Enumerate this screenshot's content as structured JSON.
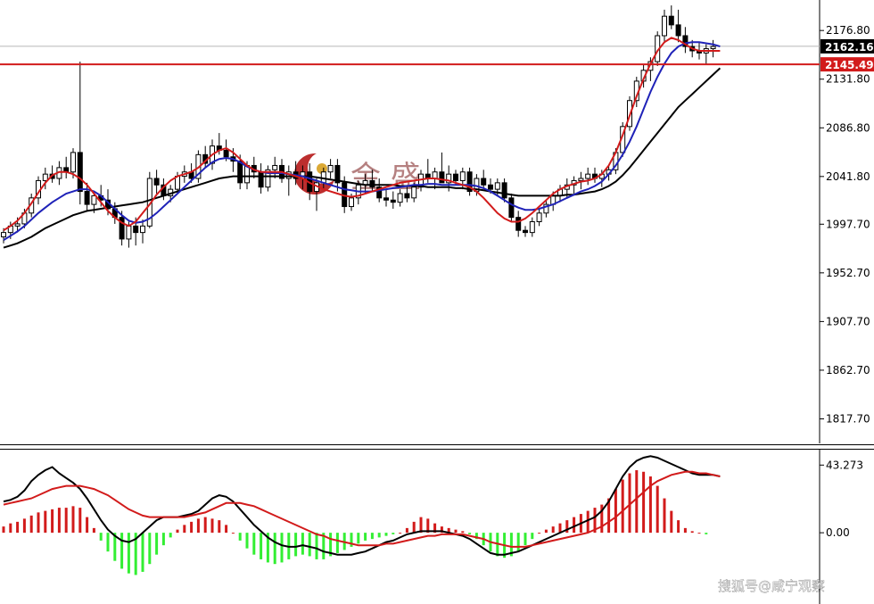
{
  "chart_data": {
    "type": "candlestick",
    "price_panel": {
      "ylim": [
        1795,
        2205
      ],
      "y_ticks": [
        "2176.80",
        "2131.80",
        "2086.80",
        "2041.80",
        "1997.70",
        "1952.70",
        "1907.70",
        "1862.70",
        "1817.70"
      ],
      "current_price": "2162.16",
      "horizontal_line_price": "2145.49",
      "candles": [
        [
          1986,
          1994,
          1980,
          1990
        ],
        [
          1990,
          2000,
          1984,
          1996
        ],
        [
          1996,
          2004,
          1990,
          1998
        ],
        [
          1998,
          2012,
          1994,
          2008
        ],
        [
          2008,
          2026,
          2004,
          2022
        ],
        [
          2022,
          2042,
          2016,
          2038
        ],
        [
          2038,
          2050,
          2030,
          2044
        ],
        [
          2044,
          2052,
          2036,
          2040
        ],
        [
          2040,
          2056,
          2034,
          2050
        ],
        [
          2050,
          2060,
          2040,
          2046
        ],
        [
          2046,
          2068,
          2040,
          2064
        ],
        [
          2064,
          2148,
          2016,
          2028
        ],
        [
          2028,
          2036,
          2010,
          2016
        ],
        [
          2016,
          2028,
          2008,
          2024
        ],
        [
          2024,
          2034,
          2014,
          2020
        ],
        [
          2020,
          2030,
          2006,
          2012
        ],
        [
          2012,
          2018,
          1998,
          2004
        ],
        [
          2004,
          2010,
          1978,
          1984
        ],
        [
          1984,
          2000,
          1976,
          1996
        ],
        [
          1996,
          2004,
          1978,
          1990
        ],
        [
          1990,
          2002,
          1980,
          1996
        ],
        [
          1996,
          2046,
          1994,
          2040
        ],
        [
          2040,
          2048,
          2026,
          2034
        ],
        [
          2034,
          2040,
          2020,
          2024
        ],
        [
          2024,
          2034,
          2018,
          2030
        ],
        [
          2030,
          2046,
          2026,
          2042
        ],
        [
          2042,
          2052,
          2036,
          2046
        ],
        [
          2046,
          2054,
          2036,
          2040
        ],
        [
          2040,
          2066,
          2036,
          2062
        ],
        [
          2062,
          2070,
          2050,
          2054
        ],
        [
          2054,
          2076,
          2048,
          2070
        ],
        [
          2070,
          2082,
          2062,
          2066
        ],
        [
          2066,
          2076,
          2056,
          2060
        ],
        [
          2060,
          2068,
          2046,
          2056
        ],
        [
          2056,
          2062,
          2030,
          2036
        ],
        [
          2036,
          2056,
          2030,
          2052
        ],
        [
          2052,
          2060,
          2040,
          2046
        ],
        [
          2046,
          2054,
          2026,
          2032
        ],
        [
          2032,
          2052,
          2028,
          2048
        ],
        [
          2048,
          2060,
          2040,
          2052
        ],
        [
          2052,
          2058,
          2036,
          2040
        ],
        [
          2040,
          2052,
          2024,
          2046
        ],
        [
          2046,
          2056,
          2034,
          2040
        ],
        [
          2040,
          2052,
          2030,
          2046
        ],
        [
          2046,
          2054,
          2020,
          2028
        ],
        [
          2028,
          2040,
          2010,
          2036
        ],
        [
          2036,
          2050,
          2030,
          2046
        ],
        [
          2046,
          2058,
          2040,
          2052
        ],
        [
          2052,
          2058,
          2028,
          2036
        ],
        [
          2036,
          2042,
          2008,
          2014
        ],
        [
          2014,
          2026,
          2010,
          2022
        ],
        [
          2022,
          2038,
          2016,
          2034
        ],
        [
          2034,
          2044,
          2026,
          2038
        ],
        [
          2038,
          2048,
          2028,
          2032
        ],
        [
          2032,
          2040,
          2018,
          2022
        ],
        [
          2022,
          2030,
          2014,
          2020
        ],
        [
          2020,
          2028,
          2012,
          2018
        ],
        [
          2018,
          2030,
          2014,
          2026
        ],
        [
          2026,
          2034,
          2018,
          2022
        ],
        [
          2022,
          2036,
          2018,
          2032
        ],
        [
          2032,
          2048,
          2028,
          2044
        ],
        [
          2044,
          2058,
          2036,
          2040
        ],
        [
          2040,
          2050,
          2030,
          2046
        ],
        [
          2046,
          2064,
          2040,
          2036
        ],
        [
          2036,
          2052,
          2028,
          2044
        ],
        [
          2044,
          2048,
          2034,
          2038
        ],
        [
          2038,
          2050,
          2030,
          2046
        ],
        [
          2046,
          2050,
          2024,
          2028
        ],
        [
          2028,
          2044,
          2024,
          2040
        ],
        [
          2040,
          2048,
          2030,
          2034
        ],
        [
          2034,
          2040,
          2026,
          2030
        ],
        [
          2030,
          2040,
          2024,
          2036
        ],
        [
          2036,
          2040,
          2018,
          2022
        ],
        [
          2022,
          2026,
          2000,
          2004
        ],
        [
          2004,
          2010,
          1986,
          1992
        ],
        [
          1992,
          1996,
          1986,
          1990
        ],
        [
          1990,
          2004,
          1986,
          2000
        ],
        [
          2000,
          2012,
          1996,
          2008
        ],
        [
          2008,
          2020,
          2004,
          2016
        ],
        [
          2016,
          2028,
          2010,
          2024
        ],
        [
          2024,
          2034,
          2018,
          2030
        ],
        [
          2030,
          2040,
          2022,
          2034
        ],
        [
          2034,
          2042,
          2026,
          2038
        ],
        [
          2038,
          2046,
          2030,
          2040
        ],
        [
          2040,
          2050,
          2034,
          2044
        ],
        [
          2044,
          2050,
          2036,
          2040
        ],
        [
          2040,
          2048,
          2032,
          2044
        ],
        [
          2044,
          2052,
          2038,
          2048
        ],
        [
          2048,
          2068,
          2044,
          2064
        ],
        [
          2064,
          2092,
          2060,
          2088
        ],
        [
          2088,
          2116,
          2084,
          2112
        ],
        [
          2112,
          2134,
          2106,
          2130
        ],
        [
          2130,
          2146,
          2124,
          2140
        ],
        [
          2140,
          2152,
          2130,
          2148
        ],
        [
          2148,
          2176,
          2144,
          2172
        ],
        [
          2172,
          2196,
          2166,
          2190
        ],
        [
          2190,
          2200,
          2178,
          2182
        ],
        [
          2182,
          2196,
          2166,
          2172
        ],
        [
          2172,
          2180,
          2156,
          2162
        ],
        [
          2162,
          2168,
          2152,
          2158
        ],
        [
          2158,
          2166,
          2150,
          2156
        ],
        [
          2156,
          2164,
          2146,
          2160
        ],
        [
          2160,
          2168,
          2152,
          2162
        ]
      ],
      "ma_red": [
        1992,
        1996,
        2001,
        2008,
        2017,
        2027,
        2036,
        2043,
        2046,
        2046,
        2044,
        2040,
        2034,
        2026,
        2018,
        2010,
        2004,
        1999,
        1996,
        2000,
        2008,
        2016,
        2025,
        2032,
        2038,
        2042,
        2044,
        2046,
        2050,
        2056,
        2062,
        2066,
        2068,
        2064,
        2058,
        2052,
        2048,
        2046,
        2046,
        2046,
        2046,
        2044,
        2042,
        2040,
        2036,
        2033,
        2030,
        2028,
        2026,
        2024,
        2023,
        2024,
        2026,
        2028,
        2030,
        2032,
        2034,
        2036,
        2037,
        2038,
        2039,
        2040,
        2040,
        2039,
        2038,
        2036,
        2034,
        2032,
        2028,
        2022,
        2015,
        2008,
        2003,
        2000,
        2000,
        2003,
        2008,
        2014,
        2020,
        2026,
        2030,
        2033,
        2035,
        2037,
        2038,
        2040,
        2044,
        2052,
        2064,
        2080,
        2098,
        2116,
        2132,
        2146,
        2158,
        2166,
        2170,
        2168,
        2164,
        2160,
        2158,
        2158,
        2158,
        2158
      ],
      "ma_blue": [
        1983,
        1987,
        1991,
        1996,
        2002,
        2008,
        2013,
        2018,
        2022,
        2026,
        2028,
        2030,
        2030,
        2028,
        2024,
        2018,
        2012,
        2006,
        2001,
        1999,
        2000,
        2003,
        2008,
        2014,
        2020,
        2026,
        2032,
        2038,
        2044,
        2050,
        2055,
        2058,
        2059,
        2058,
        2055,
        2051,
        2048,
        2046,
        2045,
        2045,
        2045,
        2044,
        2043,
        2042,
        2040,
        2038,
        2036,
        2034,
        2032,
        2030,
        2029,
        2028,
        2028,
        2028,
        2029,
        2030,
        2031,
        2032,
        2033,
        2034,
        2034,
        2035,
        2035,
        2034,
        2034,
        2034,
        2034,
        2034,
        2033,
        2031,
        2028,
        2024,
        2020,
        2016,
        2013,
        2011,
        2011,
        2012,
        2014,
        2016,
        2019,
        2022,
        2025,
        2028,
        2030,
        2033,
        2037,
        2044,
        2052,
        2062,
        2074,
        2088,
        2104,
        2120,
        2134,
        2146,
        2156,
        2162,
        2165,
        2166,
        2166,
        2165,
        2164,
        2162
      ],
      "ma_black": [
        1976,
        1978,
        1980,
        1983,
        1986,
        1990,
        1994,
        1997,
        2000,
        2003,
        2006,
        2008,
        2010,
        2011,
        2012,
        2013,
        2014,
        2015,
        2016,
        2017,
        2018,
        2020,
        2022,
        2024,
        2026,
        2028,
        2030,
        2032,
        2034,
        2036,
        2038,
        2040,
        2041,
        2042,
        2042,
        2042,
        2042,
        2042,
        2042,
        2042,
        2042,
        2042,
        2042,
        2042,
        2042,
        2041,
        2040,
        2039,
        2038,
        2037,
        2036,
        2035,
        2034,
        2034,
        2034,
        2034,
        2034,
        2033,
        2033,
        2033,
        2033,
        2032,
        2032,
        2032,
        2032,
        2031,
        2031,
        2030,
        2030,
        2029,
        2028,
        2027,
        2026,
        2025,
        2024,
        2024,
        2024,
        2024,
        2024,
        2024,
        2024,
        2025,
        2025,
        2026,
        2027,
        2028,
        2030,
        2033,
        2037,
        2043,
        2050,
        2058,
        2066,
        2074,
        2082,
        2090,
        2098,
        2106,
        2112,
        2118,
        2124,
        2130,
        2136,
        2142
      ]
    },
    "macd_panel": {
      "ylim": [
        -45,
        52
      ],
      "y_ticks": [
        "43.273",
        "0.00"
      ],
      "histogram": [
        4,
        6,
        7,
        9,
        11,
        13,
        14,
        15,
        16,
        16,
        17,
        16,
        10,
        3,
        -5,
        -12,
        -18,
        -23,
        -26,
        -27,
        -25,
        -20,
        -14,
        -8,
        -3,
        2,
        5,
        7,
        9,
        10,
        9,
        8,
        5,
        0,
        -5,
        -10,
        -14,
        -17,
        -19,
        -20,
        -19,
        -17,
        -15,
        -14,
        -15,
        -17,
        -17,
        -15,
        -13,
        -11,
        -9,
        -7,
        -5,
        -4,
        -3,
        -2,
        -1,
        0,
        3,
        7,
        10,
        9,
        6,
        4,
        3,
        2,
        1,
        -1,
        -4,
        -8,
        -12,
        -15,
        -16,
        -15,
        -12,
        -8,
        -4,
        0,
        2,
        4,
        6,
        8,
        10,
        12,
        14,
        16,
        18,
        22,
        28,
        34,
        38,
        40,
        39,
        36,
        30,
        22,
        14,
        8,
        3,
        1,
        0,
        -1
      ],
      "macd_line": [
        20,
        21,
        23,
        27,
        33,
        37,
        40,
        42,
        38,
        35,
        32,
        28,
        22,
        15,
        8,
        2,
        -2,
        -5,
        -6,
        -4,
        0,
        4,
        8,
        10,
        10,
        10,
        11,
        12,
        14,
        18,
        22,
        24,
        23,
        20,
        15,
        10,
        5,
        1,
        -3,
        -6,
        -8,
        -9,
        -9,
        -8,
        -9,
        -10,
        -12,
        -13,
        -14,
        -14,
        -14,
        -13,
        -12,
        -10,
        -8,
        -6,
        -5,
        -3,
        -1,
        0,
        1,
        1,
        1,
        1,
        0,
        -1,
        -2,
        -4,
        -7,
        -10,
        -13,
        -14,
        -14,
        -13,
        -12,
        -10,
        -8,
        -6,
        -4,
        -2,
        0,
        2,
        4,
        6,
        8,
        10,
        14,
        20,
        28,
        36,
        42,
        46,
        48,
        49,
        48,
        46,
        44,
        42,
        40,
        38,
        37,
        37,
        37,
        36
      ],
      "signal_line": [
        18,
        19,
        20,
        21,
        22,
        24,
        26,
        28,
        29,
        30,
        30,
        30,
        29,
        28,
        26,
        24,
        21,
        18,
        15,
        13,
        11,
        10,
        10,
        10,
        10,
        10,
        10,
        11,
        12,
        13,
        15,
        17,
        19,
        19,
        19,
        18,
        17,
        15,
        13,
        11,
        9,
        7,
        5,
        3,
        1,
        -1,
        -2,
        -4,
        -5,
        -6,
        -7,
        -8,
        -8,
        -8,
        -8,
        -7,
        -7,
        -6,
        -5,
        -4,
        -3,
        -2,
        -2,
        -1,
        -1,
        -1,
        -1,
        -2,
        -3,
        -4,
        -6,
        -7,
        -8,
        -9,
        -9,
        -9,
        -8,
        -7,
        -6,
        -5,
        -4,
        -3,
        -2,
        -1,
        0,
        2,
        4,
        7,
        10,
        14,
        18,
        22,
        26,
        30,
        33,
        35,
        37,
        38,
        39,
        39,
        38,
        38,
        37,
        36
      ]
    }
  },
  "watermark": {
    "text": "金 盛"
  },
  "footer_text": "搜狐号@咸宁观察",
  "colors": {
    "red": "#d21b1b",
    "blue": "#1f22b8",
    "black": "#000000",
    "macd_green": "#33ee33",
    "price_badge_bg": "#000000",
    "line_badge_bg": "#d21b1b"
  }
}
